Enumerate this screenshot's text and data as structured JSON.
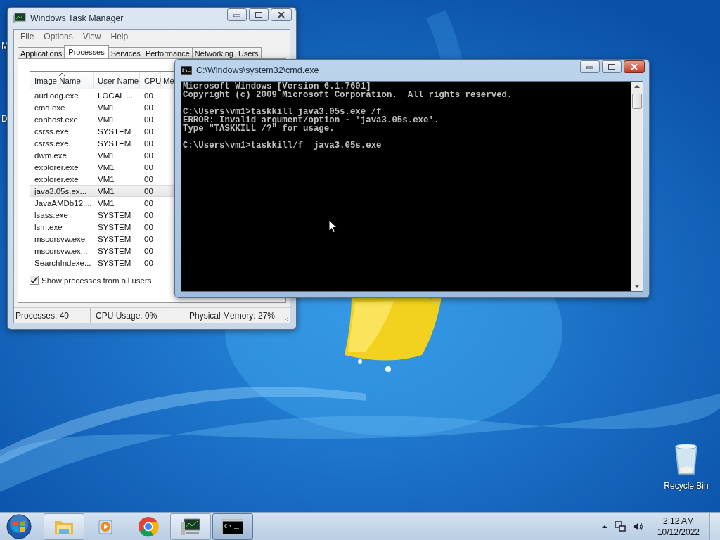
{
  "desktop": {
    "edge_labels": [
      "M",
      "D"
    ],
    "icons": [
      {
        "label": "Recycle Bin"
      }
    ]
  },
  "task_manager": {
    "title": "Windows Task Manager",
    "active": false,
    "menu": [
      "File",
      "Options",
      "View",
      "Help"
    ],
    "tabs": [
      {
        "label": "Applications",
        "selected": false
      },
      {
        "label": "Processes",
        "selected": true
      },
      {
        "label": "Services",
        "selected": false
      },
      {
        "label": "Performance",
        "selected": false
      },
      {
        "label": "Networking",
        "selected": false
      },
      {
        "label": "Users",
        "selected": false
      }
    ],
    "columns": [
      {
        "label": "Image Name",
        "sorted": true
      },
      {
        "label": "User Name",
        "sorted": false
      },
      {
        "label": "CPU",
        "sorted": false
      },
      {
        "label": "Me",
        "sorted": false
      }
    ],
    "rows": [
      {
        "cells": [
          "audiodg.exe",
          "LOCAL ...",
          "00"
        ],
        "selected": false
      },
      {
        "cells": [
          "cmd.exe",
          "VM1",
          "00"
        ],
        "selected": false
      },
      {
        "cells": [
          "conhost.exe",
          "VM1",
          "00"
        ],
        "selected": false
      },
      {
        "cells": [
          "csrss.exe",
          "SYSTEM",
          "00"
        ],
        "selected": false
      },
      {
        "cells": [
          "csrss.exe",
          "SYSTEM",
          "00"
        ],
        "selected": false
      },
      {
        "cells": [
          "dwm.exe",
          "VM1",
          "00"
        ],
        "selected": false
      },
      {
        "cells": [
          "explorer.exe",
          "VM1",
          "00"
        ],
        "selected": false
      },
      {
        "cells": [
          "explorer.exe",
          "VM1",
          "00"
        ],
        "selected": false
      },
      {
        "cells": [
          "java3.05s.ex...",
          "VM1",
          "00"
        ],
        "selected": true
      },
      {
        "cells": [
          "JavaAMDb12....",
          "VM1",
          "00"
        ],
        "selected": false
      },
      {
        "cells": [
          "lsass.exe",
          "SYSTEM",
          "00"
        ],
        "selected": false
      },
      {
        "cells": [
          "lsm.exe",
          "SYSTEM",
          "00"
        ],
        "selected": false
      },
      {
        "cells": [
          "mscorsvw.exe",
          "SYSTEM",
          "00"
        ],
        "selected": false
      },
      {
        "cells": [
          "mscorsvw.ex...",
          "SYSTEM",
          "00"
        ],
        "selected": false
      },
      {
        "cells": [
          "SearchIndexe...",
          "SYSTEM",
          "00"
        ],
        "selected": false
      }
    ],
    "show_all_users": {
      "label": "Show processes from all users",
      "checked": true
    },
    "status_bar": [
      "Processes: 40",
      "CPU Usage: 0%",
      "Physical Memory: 27%"
    ]
  },
  "console": {
    "title": "C:\\Windows\\system32\\cmd.exe",
    "active": true,
    "blocks": [
      [
        "Microsoft Windows [Version 6.1.7601]",
        "Copyright (c) 2009 Microsoft Corporation.  All rights reserved."
      ],
      [
        "C:\\Users\\vm1>taskkill java3.05s.exe /f",
        "ERROR: Invalid argument/option - 'java3.05s.exe'.",
        "Type \"TASKKILL /?\" for usage."
      ],
      [
        "C:\\Users\\vm1>taskkill/f  java3.05s.exe"
      ]
    ]
  },
  "taskbar": {
    "buttons": [
      {
        "kind": "explorer",
        "running": true,
        "selected": false
      },
      {
        "kind": "media",
        "running": false,
        "selected": false
      },
      {
        "kind": "chrome",
        "running": false,
        "selected": false
      },
      {
        "kind": "taskmgr",
        "running": true,
        "selected": false
      },
      {
        "kind": "console",
        "running": true,
        "selected": true
      }
    ],
    "clock": {
      "time": "2:12 AM",
      "date": "10/12/2022"
    }
  }
}
